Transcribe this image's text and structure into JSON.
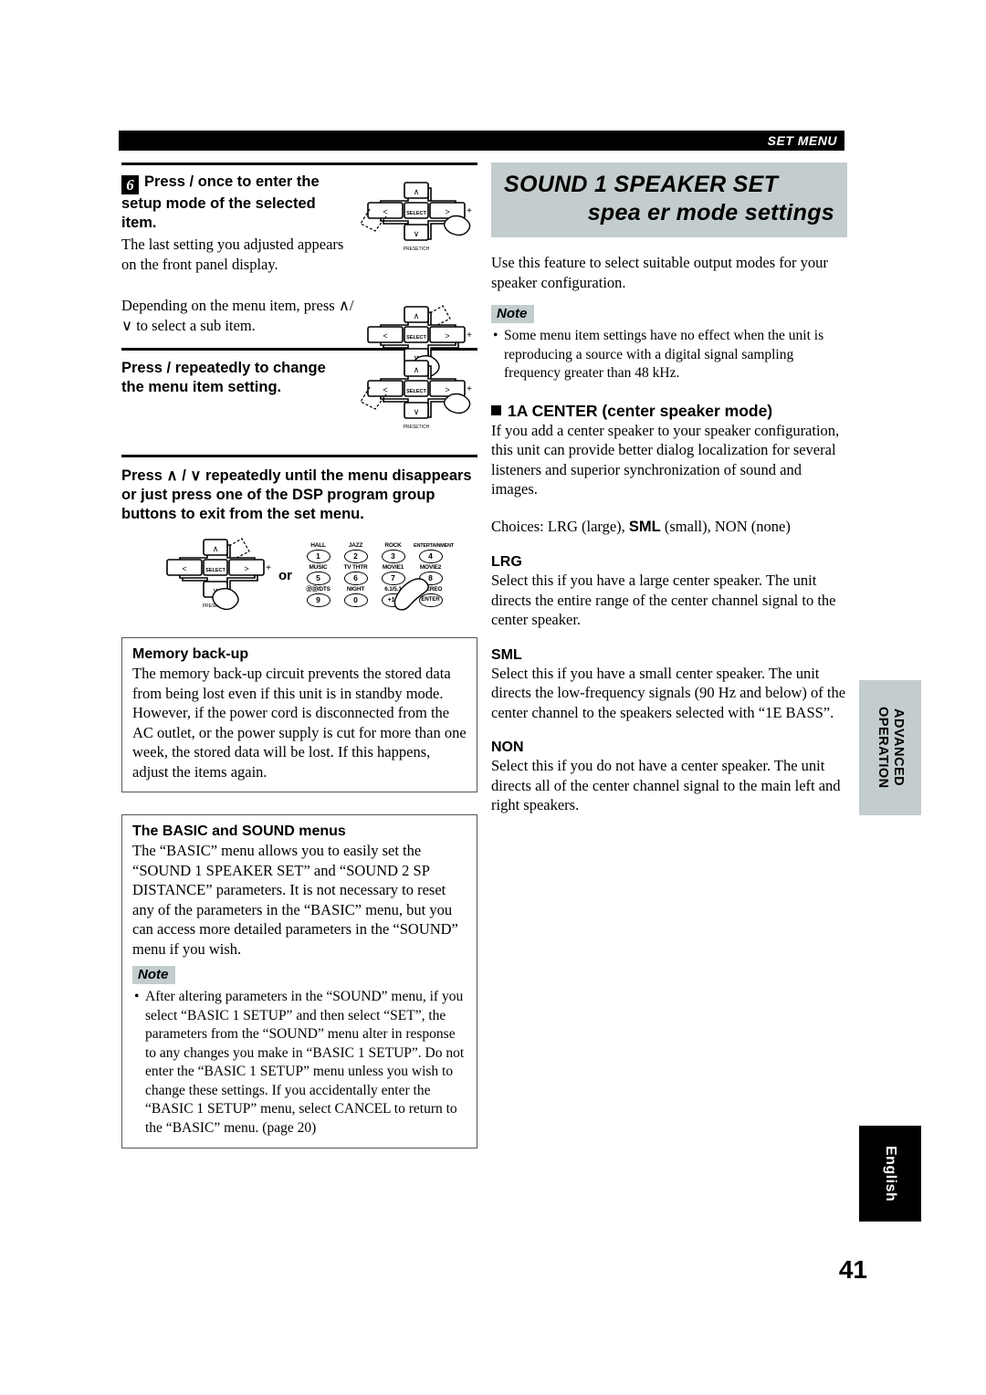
{
  "header": {
    "section_label": "SET MENU"
  },
  "left_column": {
    "step6": {
      "number": "6",
      "heading": "Press  /  once to enter the setup mode of the selected item.",
      "body1": "The last setting you adjusted appears on the front panel display.",
      "body2": "Depending on the menu item, press ∧/∨ to select a sub item."
    },
    "step_change": {
      "heading": "Press  /  repeatedly to change the menu item setting."
    },
    "step_exit": {
      "heading": "Press ∧ / ∨ repeatedly until the menu disappears or just press one of the DSP program group buttons to exit from the set menu.",
      "or_label": "or"
    },
    "memory_box": {
      "title": "Memory back-up",
      "body": "The memory back-up circuit prevents the stored data from being lost even if this unit is in standby mode. However, if the power cord is disconnected from the AC outlet, or the power supply is cut for more than one week, the stored data will be lost. If this happens, adjust the items again."
    },
    "menus_box": {
      "title": "The BASIC and SOUND menus",
      "body": "The “BASIC” menu allows you to easily set the “SOUND 1 SPEAKER SET” and “SOUND 2 SP DISTANCE” parameters. It is not necessary to reset any of the parameters in the “BASIC” menu, but you can access more detailed parameters in the “SOUND” menu if you wish.",
      "note_label": "Note",
      "note_bullet": "After altering parameters in the “SOUND” menu, if you select “BASIC 1 SETUP” and then select “SET”, the parameters from the “SOUND” menu alter in response to any changes you make in “BASIC 1 SETUP”. Do not enter the “BASIC 1 SETUP” menu unless you wish to change these settings. If you accidentally enter the “BASIC 1 SETUP” menu, select CANCEL to return to the “BASIC” menu. (page 20)"
    },
    "remote_pad": {
      "up": "∧",
      "down": "∨",
      "left": "<",
      "right": ">",
      "select": "SELECT",
      "preset": "PRESET/CH",
      "plus": "+",
      "minus": "–"
    },
    "dsp_keypad": {
      "rows": [
        [
          {
            "label": "HALL",
            "key": "1"
          },
          {
            "label": "JAZZ",
            "key": "2"
          },
          {
            "label": "ROCK",
            "key": "3"
          },
          {
            "label": "ENTERTAINMENT",
            "key": "4"
          }
        ],
        [
          {
            "label": "MUSIC",
            "key": "5"
          },
          {
            "label": "TV THTR",
            "key": "6"
          },
          {
            "label": "MOVIE1",
            "key": "7"
          },
          {
            "label": "MOVIE2",
            "key": "8"
          }
        ],
        [
          {
            "label": "ⒹⒹ/DTS",
            "key": "9"
          },
          {
            "label": "NIGHT",
            "key": "0"
          },
          {
            "label": "6.1/5.1",
            "key": "+10"
          },
          {
            "label": "STEREO",
            "key": "ENTER"
          }
        ]
      ]
    }
  },
  "right_column": {
    "banner": {
      "line1": "SOUND 1  SPEAKER SET",
      "line2": "spea er mode settings"
    },
    "intro": "Use this feature to select suitable output modes for your speaker configuration.",
    "note_label": "Note",
    "note_bullet": "Some menu item settings have no effect when the unit is reproducing a source with a digital signal sampling frequency greater than 48 kHz.",
    "section": {
      "heading": "1A CENTER (center speaker mode)",
      "body": "If you add a center speaker to your speaker configuration, this unit can provide better dialog localization for several listeners and superior synchronization of sound and images.",
      "choices_prefix": "Choices: LRG (large), ",
      "choices_bold": "SML",
      "choices_suffix": " (small), NON (none)"
    },
    "options": [
      {
        "title": "LRG",
        "body": "Select this if you have a large center speaker. The unit directs the entire range of the center channel signal to the center speaker."
      },
      {
        "title": "SML",
        "body": "Select this if you have a small center speaker. The unit directs the low-frequency signals (90 Hz and below) of the center channel to the speakers selected with “1E BASS”."
      },
      {
        "title": "NON",
        "body": "Select this if you do not have a center speaker. The unit directs all of the center channel signal to the main left and right speakers."
      }
    ]
  },
  "side_tabs": {
    "advanced": "ADVANCED\nOPERATION",
    "english": "English"
  },
  "page_number": "41",
  "colors": {
    "accent_gray": "#c3cdcd",
    "black": "#000000"
  }
}
